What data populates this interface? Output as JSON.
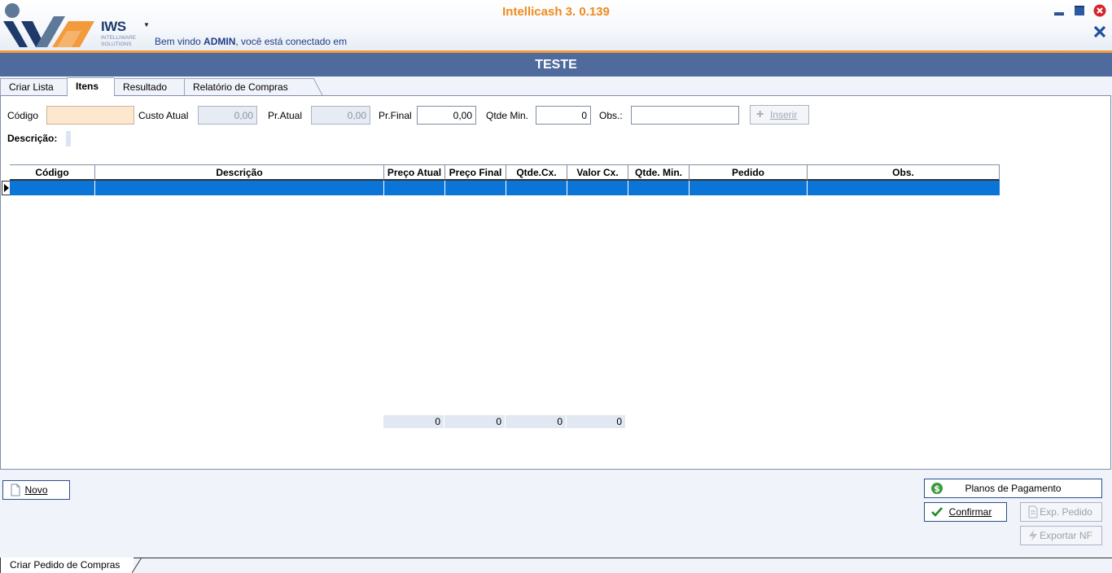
{
  "header": {
    "app_title": "Intellicash 3. 0.139",
    "logo_name": "IWS",
    "logo_sub1": "INTELLIWARE",
    "logo_sub2": "SOLUTIONS",
    "welcome_prefix": "Bem vindo ",
    "welcome_user": "ADMIN",
    "welcome_suffix": ", você está conectado em"
  },
  "page_title": "TESTE",
  "tabs": [
    {
      "label": "Criar Lista"
    },
    {
      "label": "Itens"
    },
    {
      "label": "Resultado"
    },
    {
      "label": "Relatório de Compras"
    }
  ],
  "form": {
    "codigo_label": "Código",
    "codigo_value": "",
    "custo_atual_label": "Custo Atual",
    "custo_atual_value": "0,00",
    "pr_atual_label": "Pr.Atual",
    "pr_atual_value": "0,00",
    "pr_final_label": "Pr.Final",
    "pr_final_value": "0,00",
    "qtde_min_label": "Qtde Min.",
    "qtde_min_value": "0",
    "obs_label": "Obs.:",
    "obs_value": "",
    "inserir_label": "Inserir",
    "descricao_label": "Descrição:"
  },
  "grid": {
    "columns": [
      "Código",
      "Descrição",
      "Preço Atual",
      "Preço Final",
      "Qtde.Cx.",
      "Valor Cx.",
      "Qtde. Min.",
      "Pedido",
      "Obs."
    ],
    "totals": [
      "0",
      "0",
      "0",
      "0"
    ]
  },
  "buttons": {
    "novo": "Novo",
    "planos": "Planos de Pagamento",
    "confirmar": "Confirmar",
    "exp_pedido": "Exp. Pedido",
    "exportar_nf": "Exportar NF"
  },
  "bottom_tab": "Criar Pedido de Compras",
  "colors": {
    "accent_orange": "#f08a1c",
    "title_bar": "#4f6b9d",
    "selection": "#0a75d7"
  }
}
